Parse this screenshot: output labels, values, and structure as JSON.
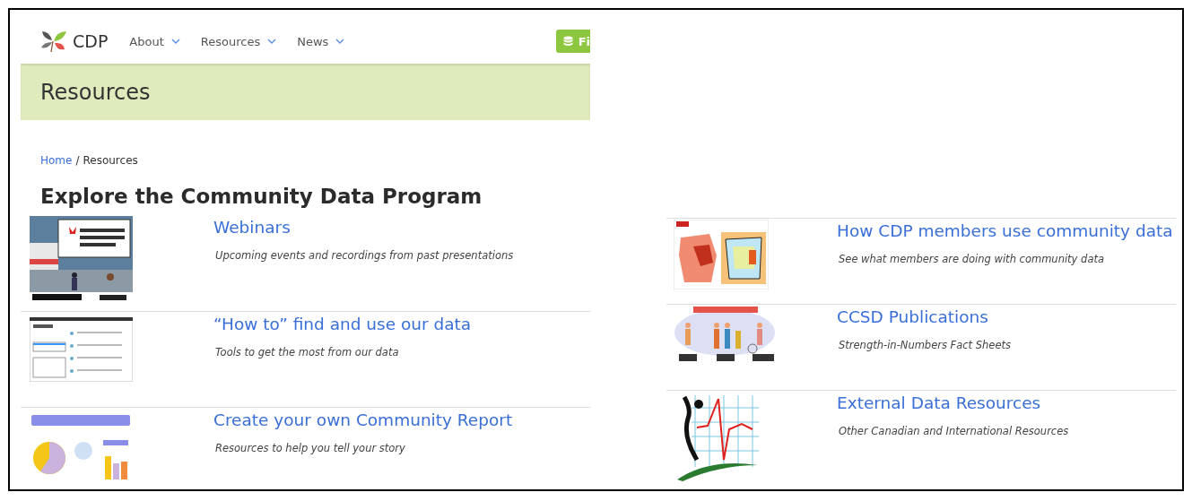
{
  "nav": {
    "logo": "CDP",
    "items": [
      {
        "label": "About"
      },
      {
        "label": "Resources"
      },
      {
        "label": "News"
      }
    ],
    "button": "Fi"
  },
  "banner": {
    "title": "Resources"
  },
  "breadcrumb": {
    "home": "Home",
    "separator": "/",
    "current": "Resources"
  },
  "heading": "Explore the Community Data Program",
  "left_items": [
    {
      "title": "Webinars",
      "description": "Upcoming events and recordings from past presentations",
      "kind": "poster"
    },
    {
      "title": "“How to” find and use our data",
      "description": "Tools to get the most from our data",
      "kind": "screenshot"
    },
    {
      "title": "Create your own Community Report",
      "description": "Resources to help you tell your story",
      "kind": "infographic"
    }
  ],
  "right_items": [
    {
      "title": "How CDP members use community data",
      "description": "See what members are doing with community data",
      "kind": "map"
    },
    {
      "title": "CCSD Publications",
      "description": "Strength-in-Numbers Fact Sheets",
      "kind": "people"
    },
    {
      "title": "External Data Resources",
      "description": "Other Canadian and International Resources",
      "kind": "heartbeat"
    }
  ]
}
